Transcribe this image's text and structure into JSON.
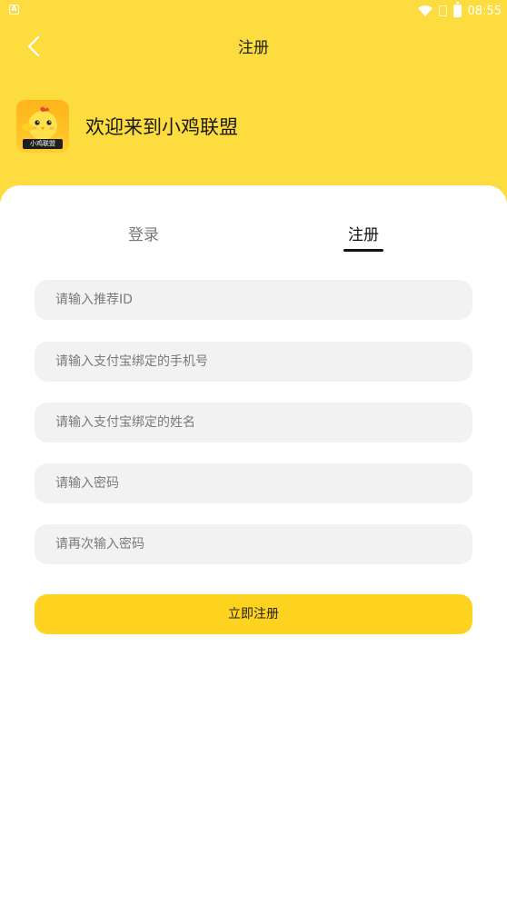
{
  "status_bar": {
    "time": "08:55",
    "notification_badge": "A"
  },
  "nav": {
    "title": "注册"
  },
  "brand": {
    "logo_text": "小鸡联盟",
    "welcome": "欢迎来到小鸡联盟"
  },
  "tabs": [
    {
      "label": "登录",
      "active": false
    },
    {
      "label": "注册",
      "active": true
    }
  ],
  "form": {
    "referrer_placeholder": "请输入推荐ID",
    "phone_placeholder": "请输入支付宝绑定的手机号",
    "name_placeholder": "请输入支付宝绑定的姓名",
    "password_placeholder": "请输入密码",
    "confirm_password_placeholder": "请再次输入密码",
    "submit_label": "立即注册"
  },
  "colors": {
    "brand_yellow": "#fcdc3e",
    "button_yellow": "#fdd320",
    "field_bg": "#f2f2f2"
  }
}
